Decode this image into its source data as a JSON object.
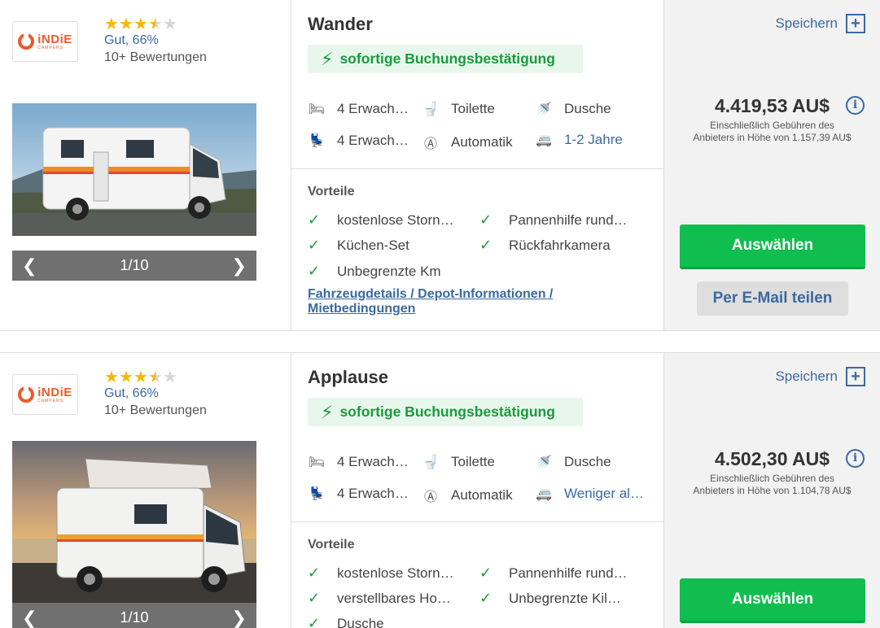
{
  "listings": [
    {
      "vendor": {
        "logo_line1": "iNDiE",
        "logo_line2": "CAMPERS"
      },
      "rating": {
        "stars": 3.5,
        "label": "Gut, 66%",
        "reviews": "10+ Bewertungen"
      },
      "carousel": {
        "counter": "1/10",
        "prev_icon": "chevron-left-icon",
        "next_icon": "chevron-right-icon"
      },
      "name": "Wander",
      "instant_booking": "sofortige Buchungsbestätigung",
      "features": [
        {
          "icon": "bed-icon",
          "label": "4 Erwach…"
        },
        {
          "icon": "toilet-icon",
          "label": "Toilette"
        },
        {
          "icon": "shower-icon",
          "label": "Dusche"
        },
        {
          "icon": "seat-icon",
          "label": "4 Erwach…"
        },
        {
          "icon": "automatic-icon",
          "label": "Automatik"
        },
        {
          "icon": "camper-age-icon",
          "label": "1-2 Jahre"
        }
      ],
      "advantages_title": "Vorteile",
      "advantages": [
        "kostenlose Storn…",
        "Pannenhilfe rund…",
        "Küchen-Set",
        "Rückfahrkamera",
        "Unbegrenzte Km"
      ],
      "details_link": "Fahrzeugdetails / Depot-Informationen / Mietbedingungen",
      "save_label": "Speichern",
      "price": "4.419,53 AU$",
      "fee_line1": "Einschließlich Gebühren des",
      "fee_line2": "Anbieters in Höhe von 1.157,39 AU$",
      "select_label": "Auswählen",
      "share_label": "Per E-Mail teilen"
    },
    {
      "vendor": {
        "logo_line1": "iNDiE",
        "logo_line2": "CAMPERS"
      },
      "rating": {
        "stars": 3.5,
        "label": "Gut, 66%",
        "reviews": "10+ Bewertungen"
      },
      "carousel": {
        "counter": "1/10",
        "prev_icon": "chevron-left-icon",
        "next_icon": "chevron-right-icon"
      },
      "name": "Applause",
      "instant_booking": "sofortige Buchungsbestätigung",
      "features": [
        {
          "icon": "bed-icon",
          "label": "4 Erwach…"
        },
        {
          "icon": "toilet-icon",
          "label": "Toilette"
        },
        {
          "icon": "shower-icon",
          "label": "Dusche"
        },
        {
          "icon": "seat-icon",
          "label": "4 Erwach…"
        },
        {
          "icon": "automatic-icon",
          "label": "Automatik"
        },
        {
          "icon": "camper-age-icon",
          "label": "Weniger al…"
        }
      ],
      "advantages_title": "Vorteile",
      "advantages": [
        "kostenlose Storn…",
        "Pannenhilfe rund…",
        "verstellbares Ho…",
        "Unbegrenzte Kil…",
        "Dusche"
      ],
      "save_label": "Speichern",
      "price": "4.502,30 AU$",
      "fee_line1": "Einschließlich Gebühren des",
      "fee_line2": "Anbieters in Höhe von 1.104,78 AU$",
      "select_label": "Auswählen"
    }
  ],
  "colors": {
    "accent_green": "#0fbe4f",
    "link_blue": "#3b6aa0",
    "star_gold": "#f5b800",
    "brand_orange": "#ea5a2b"
  }
}
